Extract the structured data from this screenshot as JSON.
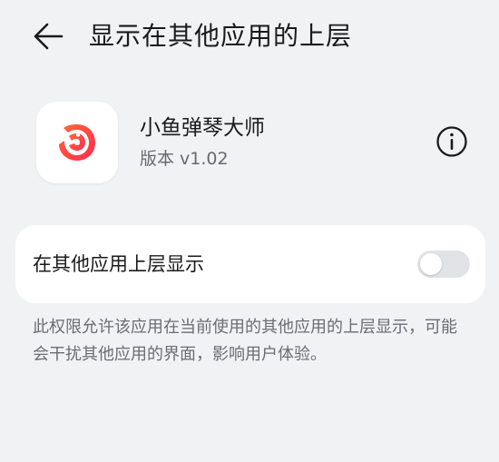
{
  "header": {
    "title": "显示在其他应用的上层",
    "back_icon": "back-arrow-icon"
  },
  "app": {
    "name": "小鱼弹琴大师",
    "version": "版本 v1.02",
    "icon": "fish-logo-icon",
    "brand_colors": [
      "#ff2a4d",
      "#ff6a3c"
    ]
  },
  "info": {
    "icon": "info-icon"
  },
  "setting": {
    "label": "在其他应用上层显示",
    "enabled": false
  },
  "description": "此权限允许该应用在当前使用的其他应用的上层显示，可能会干扰其他应用的界面，影响用户体验。"
}
